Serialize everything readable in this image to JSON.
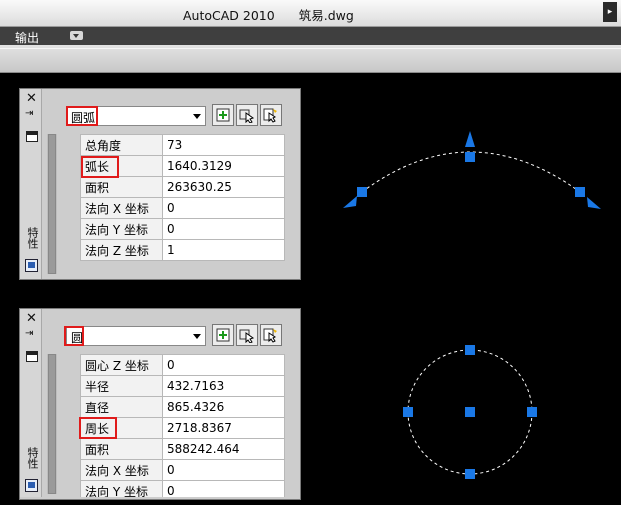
{
  "app": {
    "title": "AutoCAD 2010",
    "file": "筑易.dwg",
    "scroll_label": "▸"
  },
  "menu": {
    "output": "输出"
  },
  "palettes": [
    {
      "object_type": "圆弧",
      "side_label": "特性",
      "rows": [
        {
          "key": "总角度",
          "value": "73"
        },
        {
          "key": "弧长",
          "value": "1640.3129"
        },
        {
          "key": "面积",
          "value": "263630.25"
        },
        {
          "key": "法向 X 坐标",
          "value": "0"
        },
        {
          "key": "法向 Y 坐标",
          "value": "0"
        },
        {
          "key": "法向 Z 坐标",
          "value": "1"
        }
      ]
    },
    {
      "object_type": "圆",
      "side_label": "特性",
      "rows": [
        {
          "key": "圆心 Z 坐标",
          "value": "0"
        },
        {
          "key": "半径",
          "value": "432.7163"
        },
        {
          "key": "直径",
          "value": "865.4326"
        },
        {
          "key": "周长",
          "value": "2718.8367"
        },
        {
          "key": "面积",
          "value": "588242.464"
        },
        {
          "key": "法向 X 坐标",
          "value": "0"
        },
        {
          "key": "法向 Y 坐标",
          "value": "0"
        }
      ]
    }
  ],
  "colors": {
    "grip": "#1a78e6",
    "highlight": "#e01b1b",
    "canvas": "#000000"
  }
}
